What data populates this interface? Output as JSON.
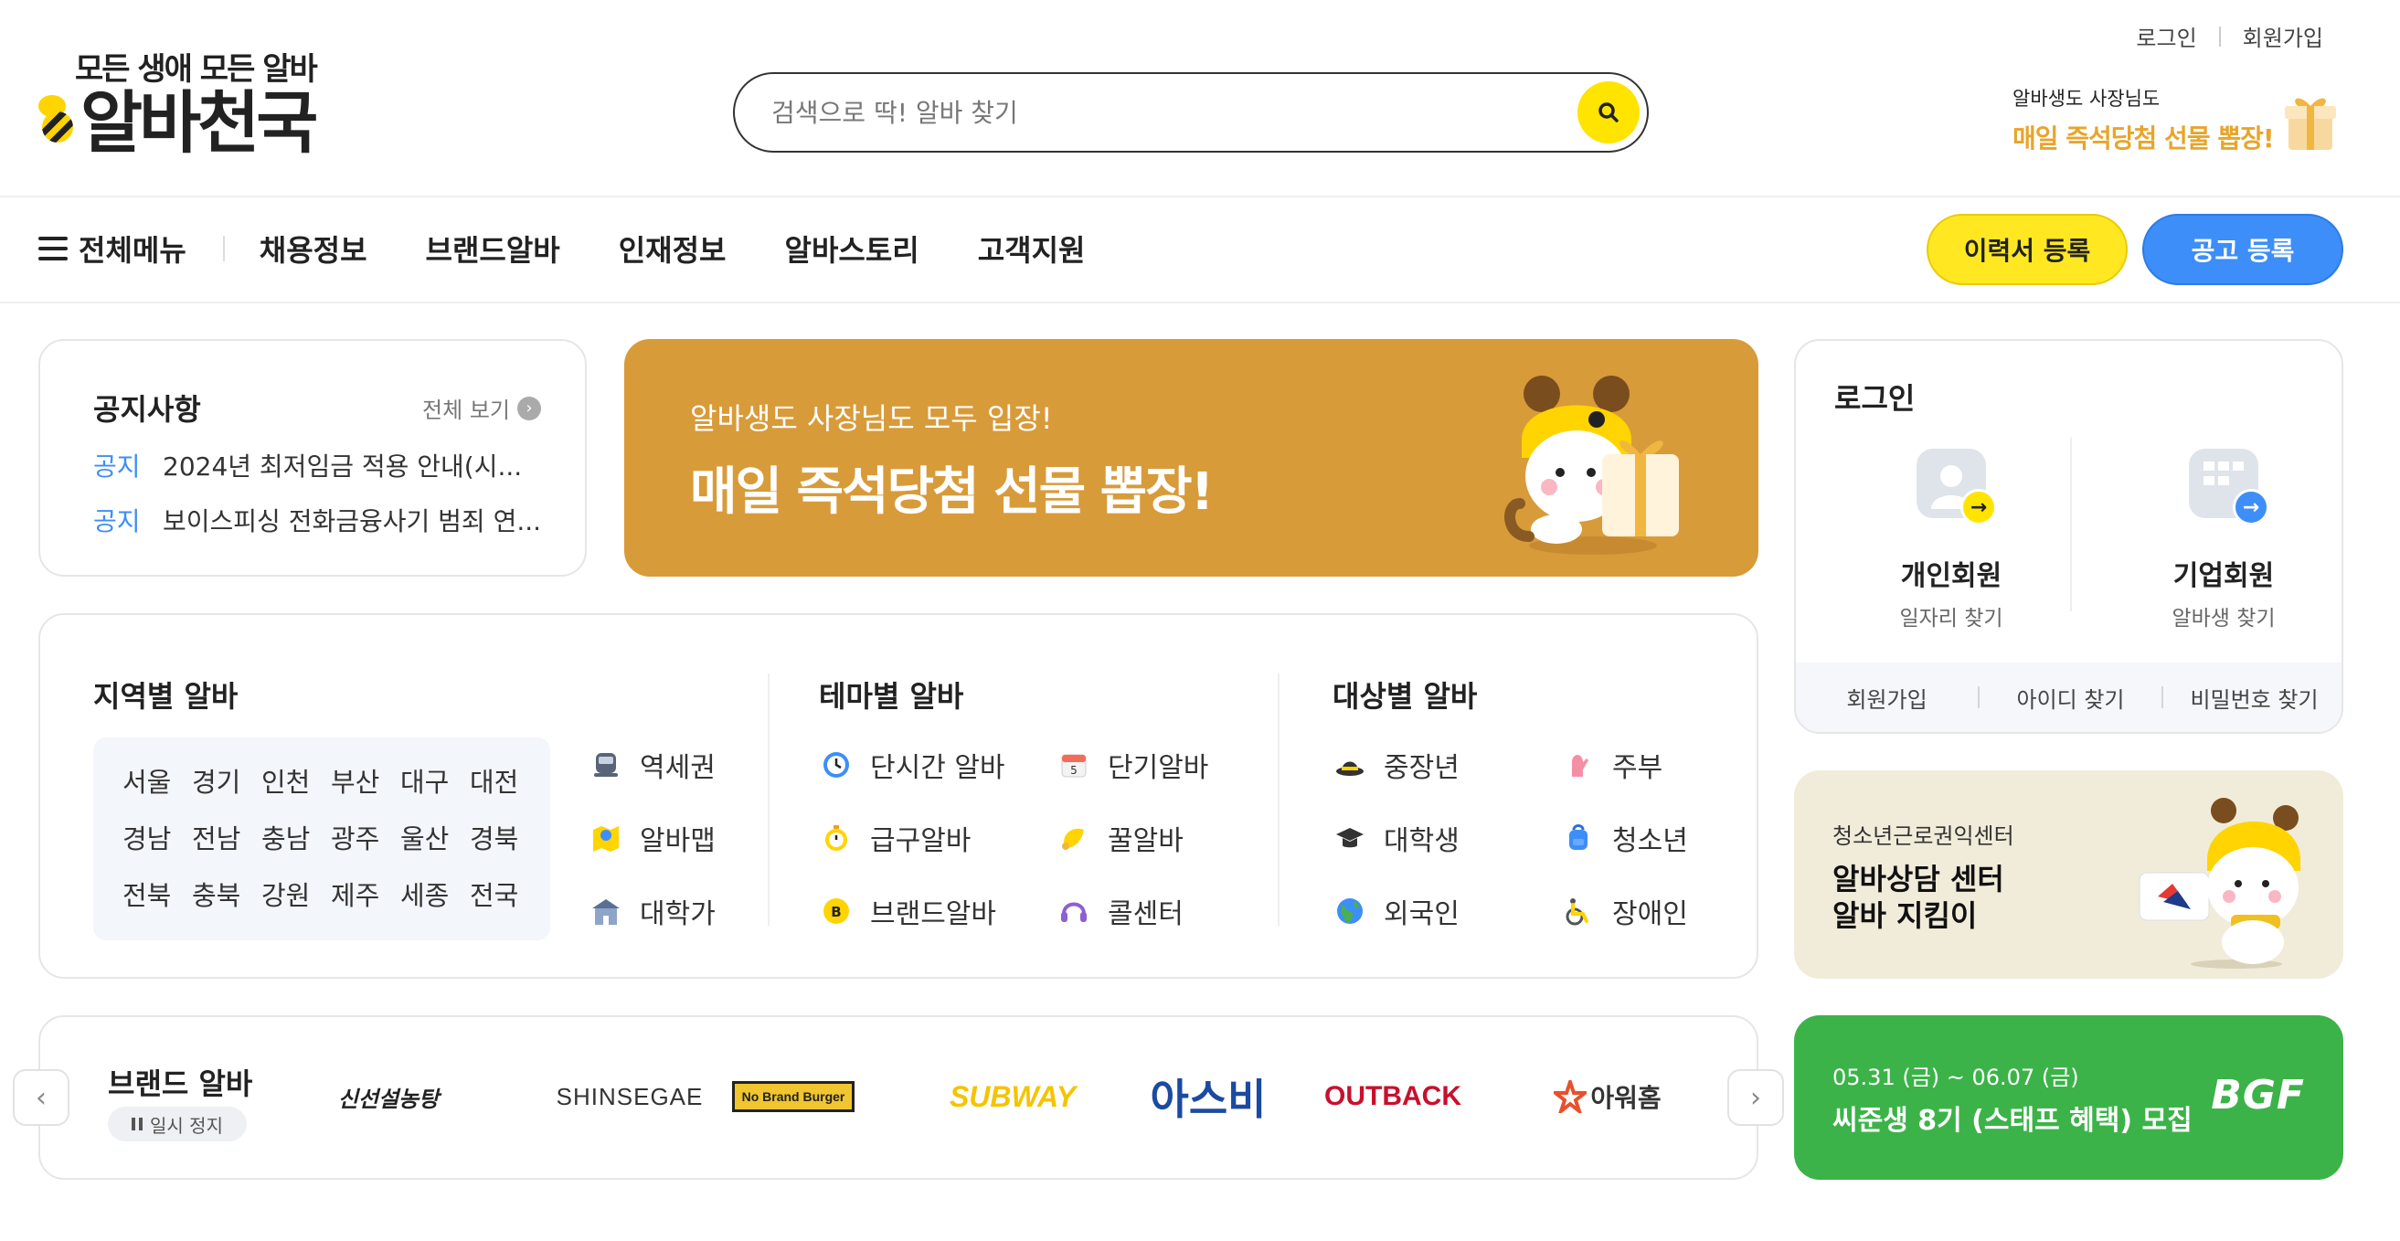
{
  "header": {
    "logo_tagline": "모든 생애 모든 알바",
    "logo_text": "알바천국",
    "search_placeholder": "검색으로 딱! 알바 찾기",
    "top_links": [
      "로그인",
      "회원가입"
    ],
    "promo_small": "알바생도 사장님도",
    "promo_big": "매일 즉석당첨 선물 뽑장!"
  },
  "nav": {
    "menu_label": "전체메뉴",
    "items": [
      "채용정보",
      "브랜드알바",
      "인재정보",
      "알바스토리",
      "고객지원"
    ],
    "resume_button": "이력서 등록",
    "post_button": "공고 등록"
  },
  "notice": {
    "title": "공지사항",
    "view_all": "전체 보기",
    "items": [
      {
        "tag": "공지",
        "text": "2024년 최저임금 적용 안내(시..."
      },
      {
        "tag": "공지",
        "text": "보이스피싱 전화금융사기 범죄 연..."
      }
    ]
  },
  "banner": {
    "sub": "알바생도 사장님도 모두 입장!",
    "main": "매일 즉석당첨 선물 뽑장!"
  },
  "categories": {
    "region": {
      "title": "지역별 알바",
      "regions": [
        "서울",
        "경기",
        "인천",
        "부산",
        "대구",
        "대전",
        "경남",
        "전남",
        "충남",
        "광주",
        "울산",
        "경북",
        "전북",
        "충북",
        "강원",
        "제주",
        "세종",
        "전국"
      ],
      "links": [
        {
          "label": "역세권",
          "icon": "subway-icon"
        },
        {
          "label": "알바맵",
          "icon": "map-icon"
        },
        {
          "label": "대학가",
          "icon": "university-icon"
        }
      ]
    },
    "theme": {
      "title": "테마별 알바",
      "items": [
        {
          "label": "단시간 알바",
          "icon": "clock-icon"
        },
        {
          "label": "단기알바",
          "icon": "calendar-icon"
        },
        {
          "label": "급구알바",
          "icon": "stopwatch-icon"
        },
        {
          "label": "꿀알바",
          "icon": "honey-icon"
        },
        {
          "label": "브랜드알바",
          "icon": "brand-badge-icon"
        },
        {
          "label": "콜센터",
          "icon": "headset-icon"
        }
      ]
    },
    "target": {
      "title": "대상별 알바",
      "items": [
        {
          "label": "중장년",
          "icon": "hat-icon"
        },
        {
          "label": "주부",
          "icon": "rubber-glove-icon"
        },
        {
          "label": "대학생",
          "icon": "graduation-cap-icon"
        },
        {
          "label": "청소년",
          "icon": "backpack-icon"
        },
        {
          "label": "외국인",
          "icon": "globe-icon"
        },
        {
          "label": "장애인",
          "icon": "wheelchair-icon"
        }
      ]
    }
  },
  "login": {
    "title": "로그인",
    "personal": {
      "name": "개인회원",
      "desc": "일자리 찾기"
    },
    "business": {
      "name": "기업회원",
      "desc": "알바생 찾기"
    },
    "footer": [
      "회원가입",
      "아이디 찾기",
      "비밀번호 찾기"
    ]
  },
  "youth": {
    "sub": "청소년근로권익센터",
    "line1": "알바상담 센터",
    "line2": "알바 지킴이"
  },
  "brand": {
    "title": "브랜드 알바",
    "pause": "일시 정지",
    "logos": [
      "신선설농탕",
      "SHINSEGAE",
      "No Brand Burger",
      "SUBWAY",
      "아스비",
      "OUTBACK",
      "아워홈"
    ]
  },
  "bgf": {
    "date": "05.31 (금) ~ 06.07 (금)",
    "title": "씨준생 8기 (스태프 혜택) 모집",
    "logo": "BGF"
  },
  "colors": {
    "brand_yellow": "#ffe400",
    "brand_blue": "#3d8ef8",
    "banner_orange": "#d89b3a",
    "bgf_green": "#3cb349"
  }
}
